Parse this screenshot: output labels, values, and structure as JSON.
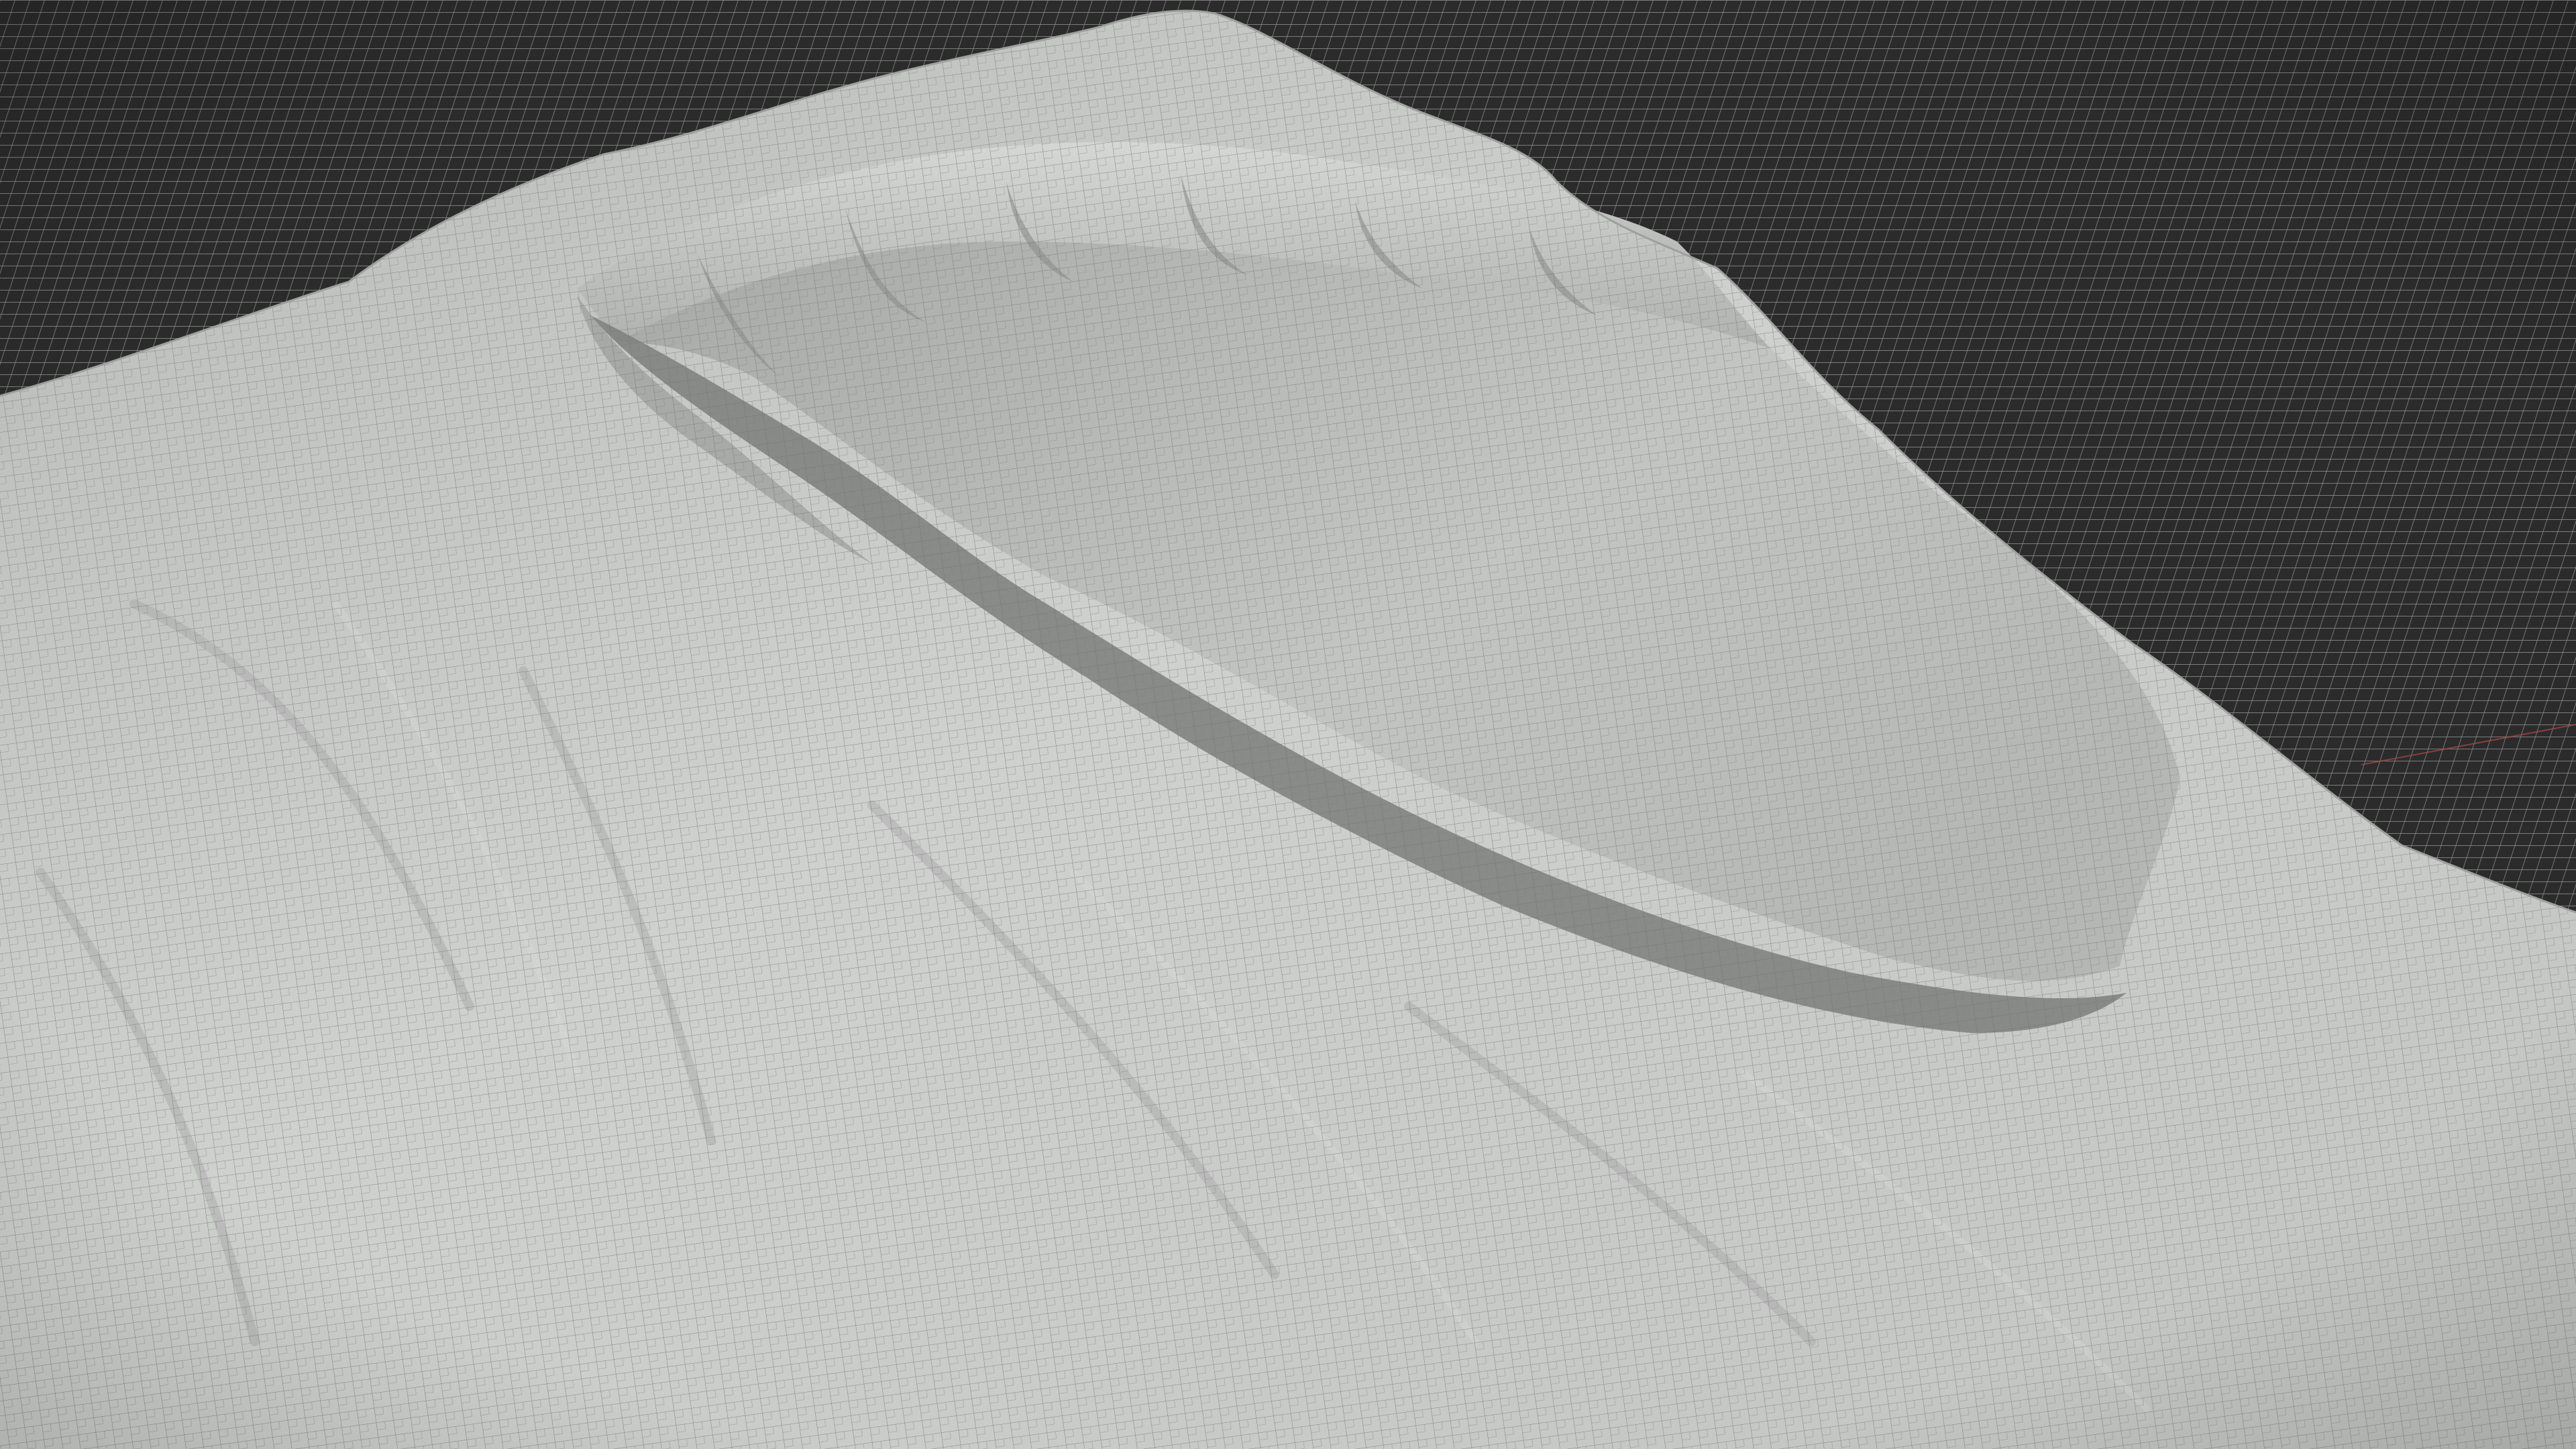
{
  "scene": {
    "subject": "terrain-mesh",
    "render_style": "wireframe-clay",
    "colors": {
      "background": "#2b2b2b",
      "ground_grid": "#9a9a9a",
      "terrain_fill": "#c4c6c4",
      "terrain_shadow": "#8f918f",
      "terrain_highlight": "#d8dad8",
      "wire": "#6c6e6c",
      "axis_red": "#b04848"
    }
  }
}
